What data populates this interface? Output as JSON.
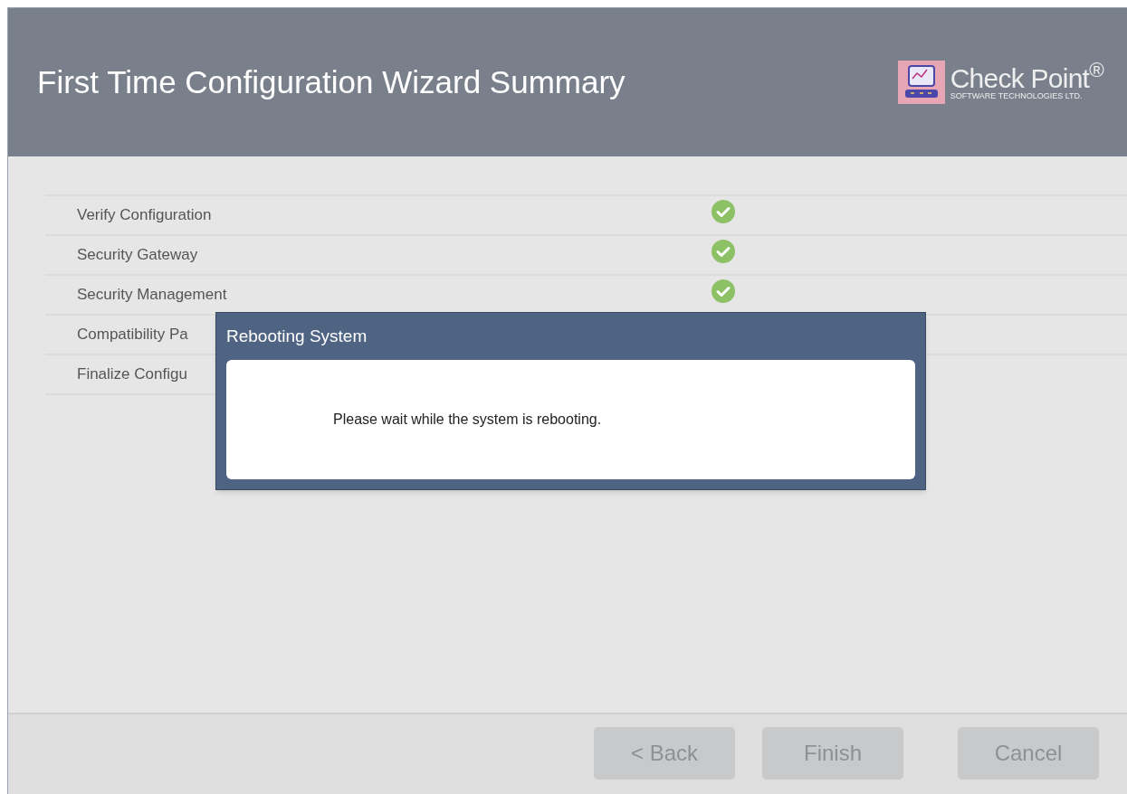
{
  "window": {
    "title": "First Time Configuration Wizard Summary"
  },
  "logo": {
    "name": "Check Point$^{®}$",
    "tagline": "SOFTWARE TECHNOLOGIES LTD."
  },
  "steps": [
    {
      "label": "Verify Configuration",
      "done": true
    },
    {
      "label": "Security Gateway",
      "done": true
    },
    {
      "label": "Security Management",
      "done": true
    },
    {
      "label": "Compatibility Pa"
    },
    {
      "label": "Finalize Configu"
    }
  ],
  "dialog": {
    "title": "Rebooting System",
    "message": "Please wait while the system is rebooting."
  },
  "buttons": [
    {
      "label": "< Back",
      "disabled": true
    },
    {
      "label": "Finish",
      "disabled": true
    },
    {
      "label": "Cancel",
      "disabled": true
    }
  ]
}
